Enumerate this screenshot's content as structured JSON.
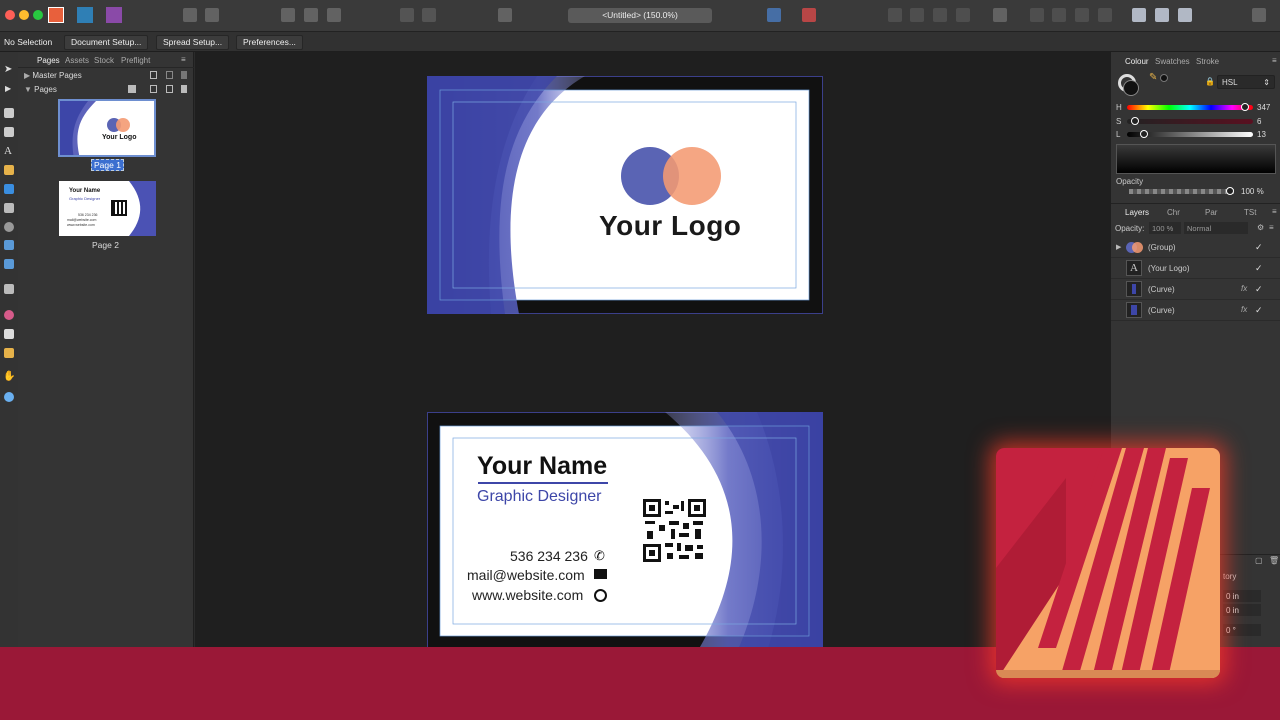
{
  "toolbar": {
    "doc_title": "<Untitled> (150.0%)"
  },
  "context_bar": {
    "selection": "No Selection",
    "buttons": [
      "Document Setup...",
      "Spread Setup...",
      "Preferences..."
    ]
  },
  "pages_panel": {
    "tabs": [
      "Pages",
      "Assets",
      "Stock",
      "Preflight"
    ],
    "master_pages": "Master Pages",
    "pages_label": "Pages",
    "pages": [
      {
        "label": "Page 1",
        "selected": true
      },
      {
        "label": "Page 2",
        "selected": false
      }
    ]
  },
  "right_panel": {
    "tabs": [
      "Colour",
      "Swatches",
      "Stroke"
    ],
    "color_model": "HSL",
    "h_label": "H",
    "h_value": "347",
    "s_label": "S",
    "s_value": "6",
    "l_label": "L",
    "l_value": "13",
    "opacity_label": "Opacity",
    "opacity_value": "100 %",
    "layer_tabs": [
      "Layers",
      "Chr",
      "Par",
      "TSt"
    ],
    "layer_opacity_label": "Opacity:",
    "layer_opacity_value": "100 %",
    "blend_mode": "Normal",
    "layers": [
      {
        "name": "(Group)",
        "fx": ""
      },
      {
        "name": "(Your Logo)",
        "fx": ""
      },
      {
        "name": "(Curve)",
        "fx": "fx"
      },
      {
        "name": "(Curve)",
        "fx": "fx"
      }
    ],
    "history_label": "tory",
    "history_values": [
      "0 in",
      "0 in",
      "0 °"
    ]
  },
  "card_front": {
    "logo_text": "Your Logo"
  },
  "card_back": {
    "name": "Your Name",
    "title": "Graphic Designer",
    "phone": "536 234 236",
    "email": "mail@website.com",
    "website": "www.website.com"
  },
  "thumb_front": {
    "logo_text": "Your Logo"
  },
  "thumb_back": {
    "name": "Your Name",
    "title": "Graphic Designer",
    "phone": "536 234 236",
    "email": "mail@website.com",
    "website": "www.website.com"
  },
  "colors": {
    "brand_blue": "#5a64b4",
    "brand_orange": "#f49a72",
    "promo_red": "#9a1837",
    "icon_orange": "#f6a266",
    "icon_crimson": "#c4223f"
  }
}
